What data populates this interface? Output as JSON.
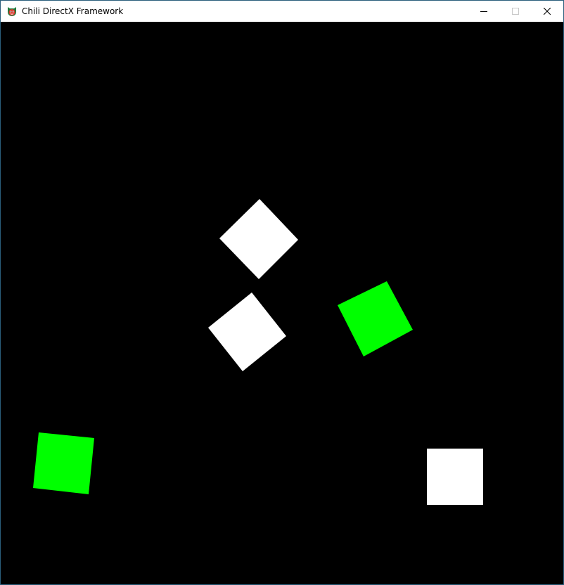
{
  "window": {
    "title": "Chili DirectX Framework",
    "icon": "chili-app-icon",
    "controls": [
      "minimize-icon",
      "maximize-icon",
      "close-icon"
    ]
  },
  "scene": {
    "background": "#000000",
    "boxes": [
      {
        "id": "box-white-1",
        "color": "#ffffff"
      },
      {
        "id": "box-white-2",
        "color": "#ffffff"
      },
      {
        "id": "box-green-1",
        "color": "#00ff00"
      },
      {
        "id": "box-green-2",
        "color": "#00ff00"
      },
      {
        "id": "box-white-3",
        "color": "#ffffff"
      }
    ]
  }
}
